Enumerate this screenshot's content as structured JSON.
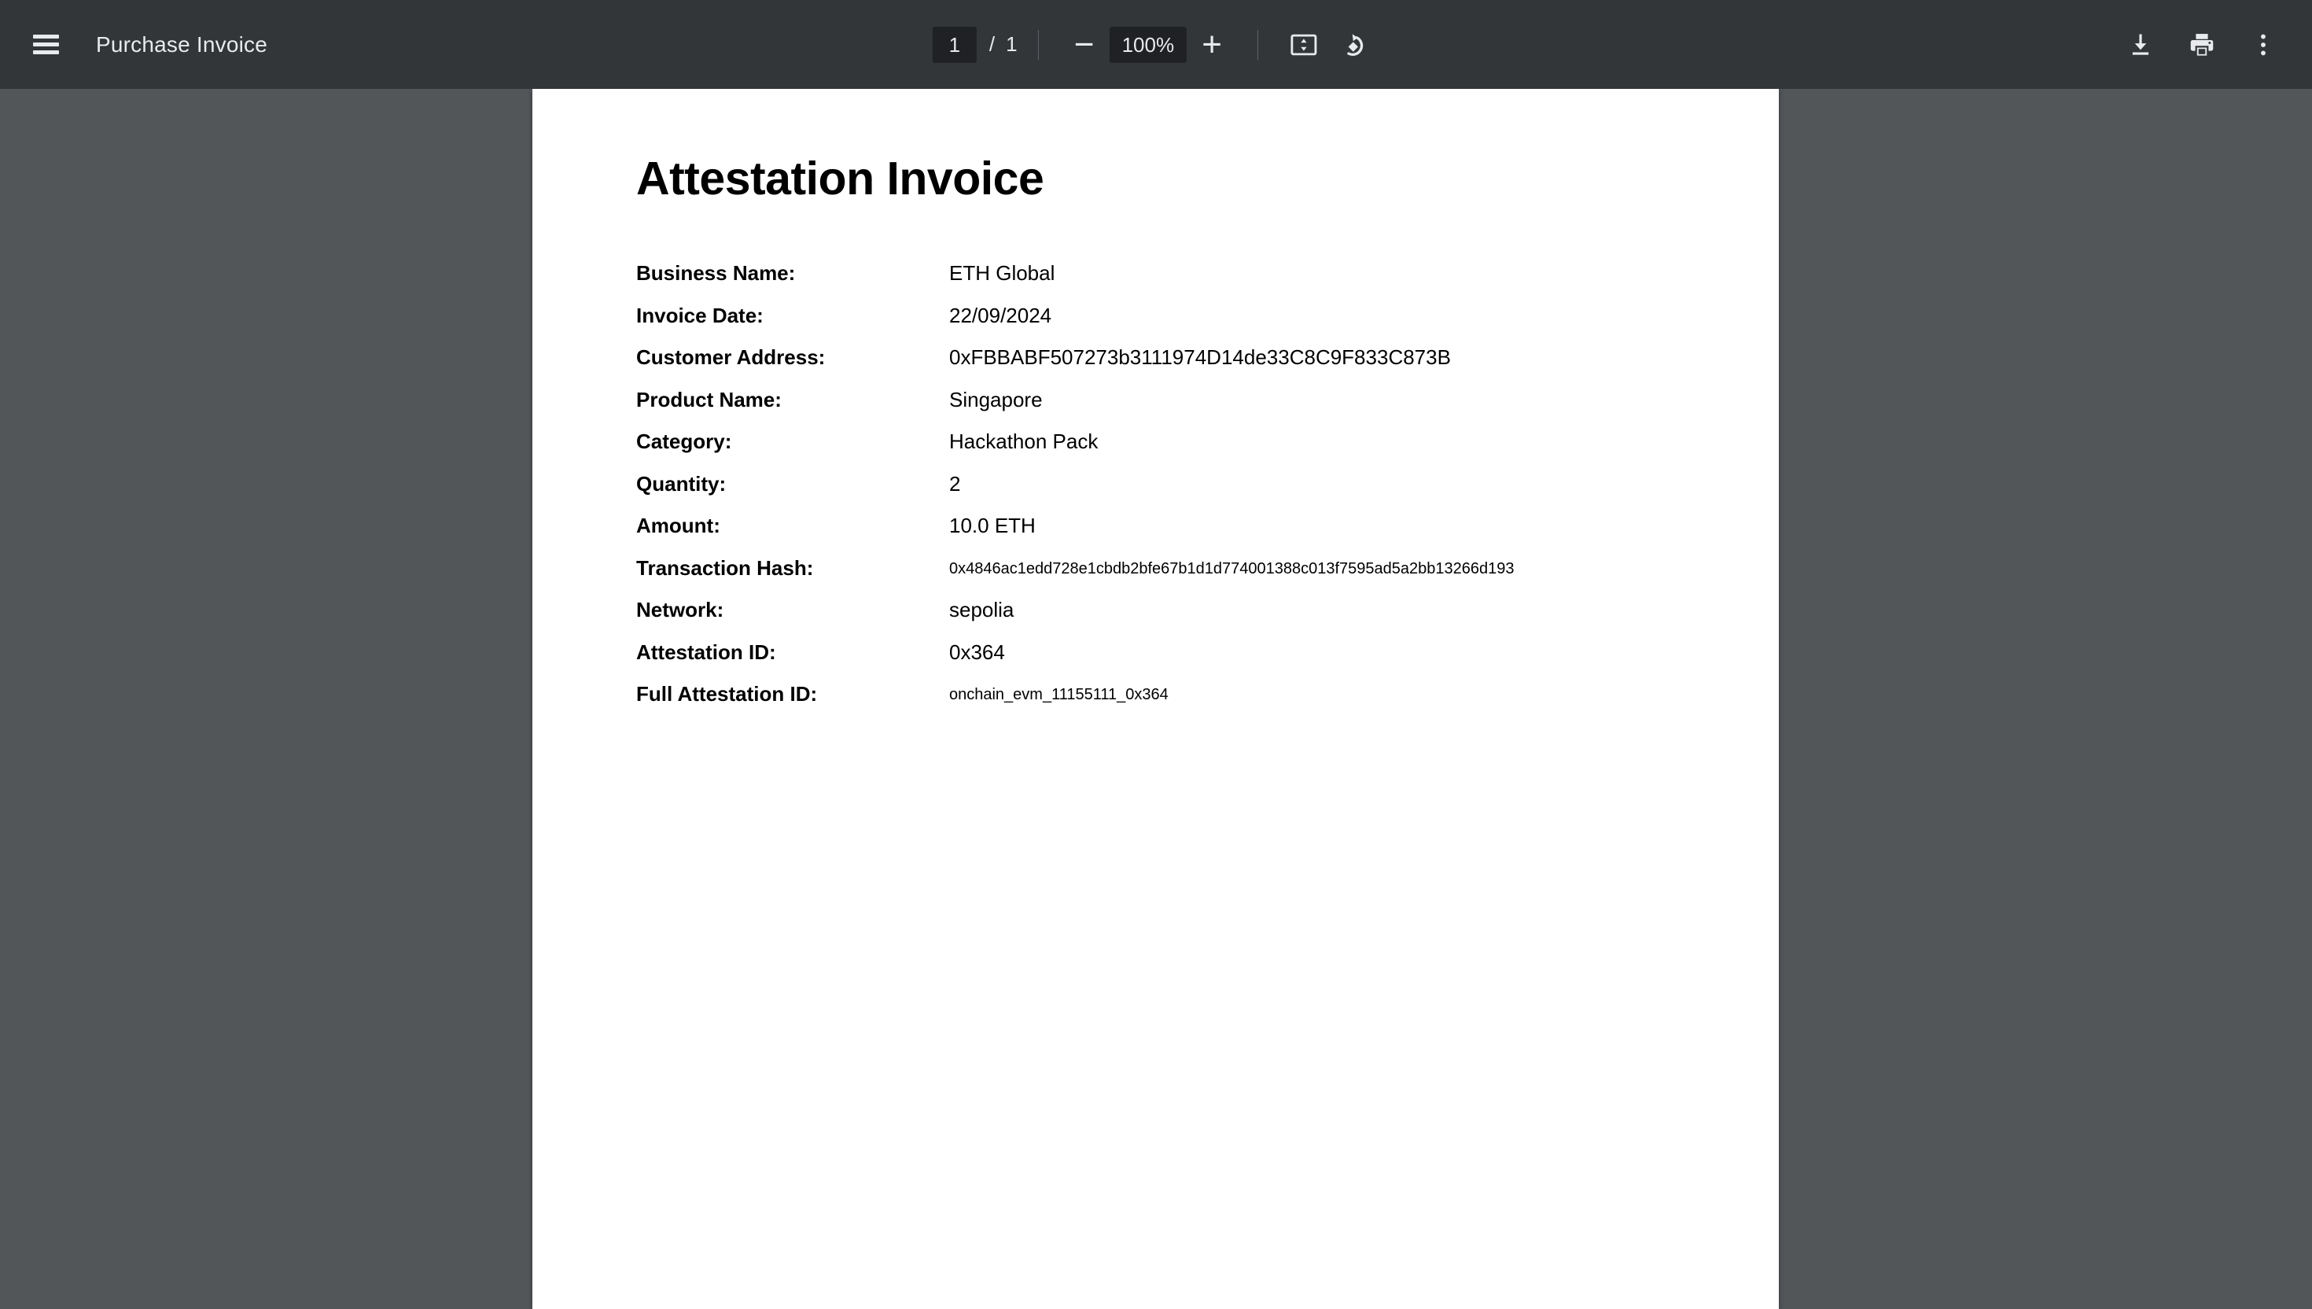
{
  "toolbar": {
    "menu_icon": "hamburger-menu-icon",
    "title": "Purchase Invoice",
    "page_current": "1",
    "page_separator": "/",
    "page_total": "1",
    "zoom_out_label": "−",
    "zoom_level": "100%",
    "zoom_in_label": "+",
    "fit_icon": "fit-to-page-icon",
    "rotate_icon": "rotate-counterclockwise-icon",
    "download_icon": "download-icon",
    "print_icon": "print-icon",
    "more_icon": "more-options-icon",
    "bg_color": "#323639",
    "text_color": "#e8eaed",
    "input_bg_color": "#202124"
  },
  "viewer": {
    "background_color": "#525659",
    "page_background_color": "#ffffff"
  },
  "document": {
    "title": "Attestation Invoice",
    "fields": [
      {
        "label": "Business Name:",
        "value": "ETH Global",
        "small": false
      },
      {
        "label": "Invoice Date:",
        "value": "22/09/2024",
        "small": false
      },
      {
        "label": "Customer Address:",
        "value": "0xFBBABF507273b3111974D14de33C8C9F833C873B",
        "small": false
      },
      {
        "label": "Product Name:",
        "value": "Singapore",
        "small": false
      },
      {
        "label": "Category:",
        "value": "Hackathon Pack",
        "small": false
      },
      {
        "label": "Quantity:",
        "value": "2",
        "small": false
      },
      {
        "label": "Amount:",
        "value": "10.0 ETH",
        "small": false
      },
      {
        "label": "Transaction Hash:",
        "value": "0x4846ac1edd728e1cbdb2bfe67b1d1d774001388c013f7595ad5a2bb13266d193",
        "small": true
      },
      {
        "label": "Network:",
        "value": "sepolia",
        "small": false
      },
      {
        "label": "Attestation ID:",
        "value": "0x364",
        "small": false
      },
      {
        "label": "Full Attestation ID:",
        "value": "onchain_evm_11155111_0x364",
        "small": true
      }
    ]
  }
}
